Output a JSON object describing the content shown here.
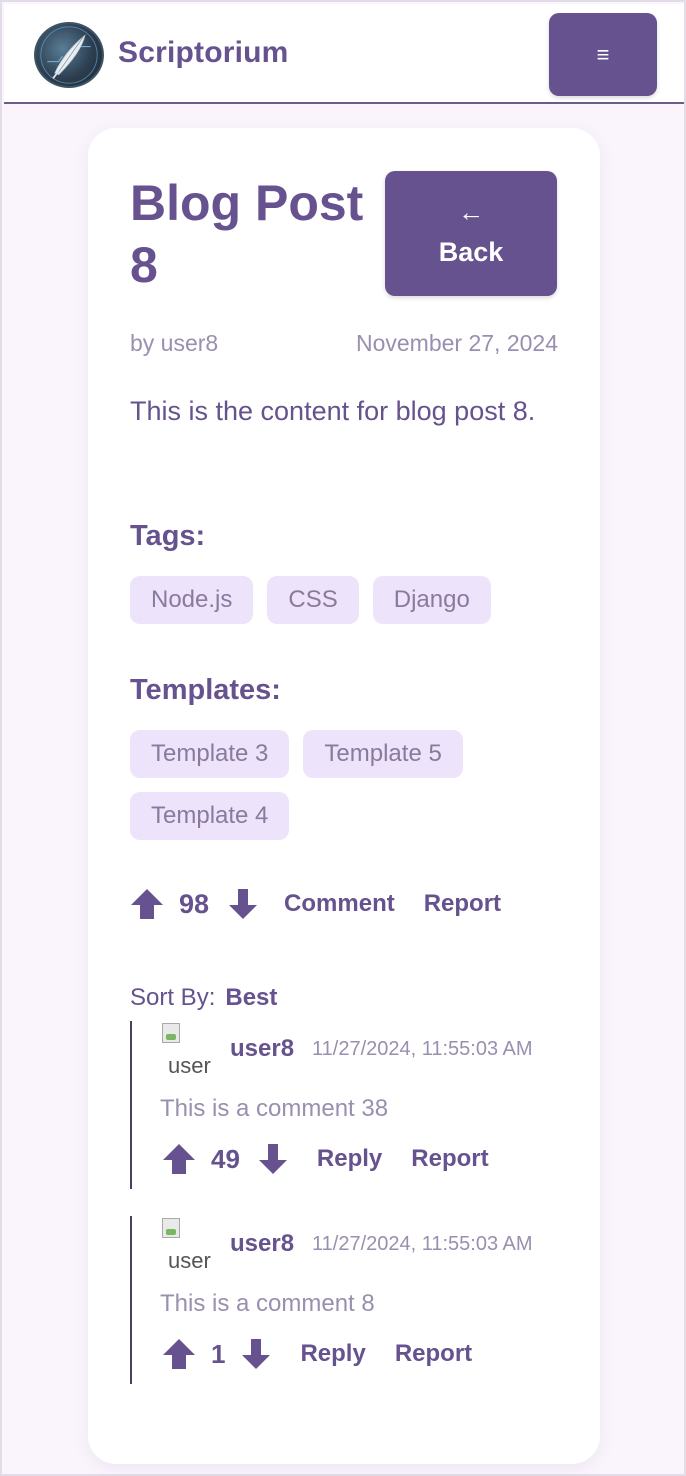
{
  "navbar": {
    "brand": "Scriptorium",
    "menu_icon": "≡",
    "logo_icon": "quill-logo-icon"
  },
  "post": {
    "title": "Blog Post 8",
    "back_arrow": "←",
    "back_label": "Back",
    "author": "by user8",
    "date": "November 27, 2024",
    "content": "This is the content for blog post 8.",
    "tags_heading": "Tags:",
    "tags": [
      "Node.js",
      "CSS",
      "Django"
    ],
    "templates_heading": "Templates:",
    "templates": [
      "Template 3",
      "Template 5",
      "Template 4"
    ],
    "votes": "98",
    "comment_label": "Comment",
    "report_label": "Report"
  },
  "sort": {
    "label": "Sort By:",
    "value": "Best"
  },
  "comments": [
    {
      "user": "user8",
      "avatar_alt": "user",
      "time": "11/27/2024, 11:55:03 AM",
      "text": "This is a comment 38",
      "votes": "49",
      "reply_label": "Reply",
      "report_label": "Report"
    },
    {
      "user": "user8",
      "avatar_alt": "user",
      "time": "11/27/2024, 11:55:03 AM",
      "text": "This is a comment 8",
      "votes": "1",
      "reply_label": "Reply",
      "report_label": "Report"
    }
  ],
  "colors": {
    "accent": "#65528e",
    "chip_bg": "#ede3fa",
    "page_bg": "#faf5fc",
    "muted_text": "#9a8fae"
  }
}
